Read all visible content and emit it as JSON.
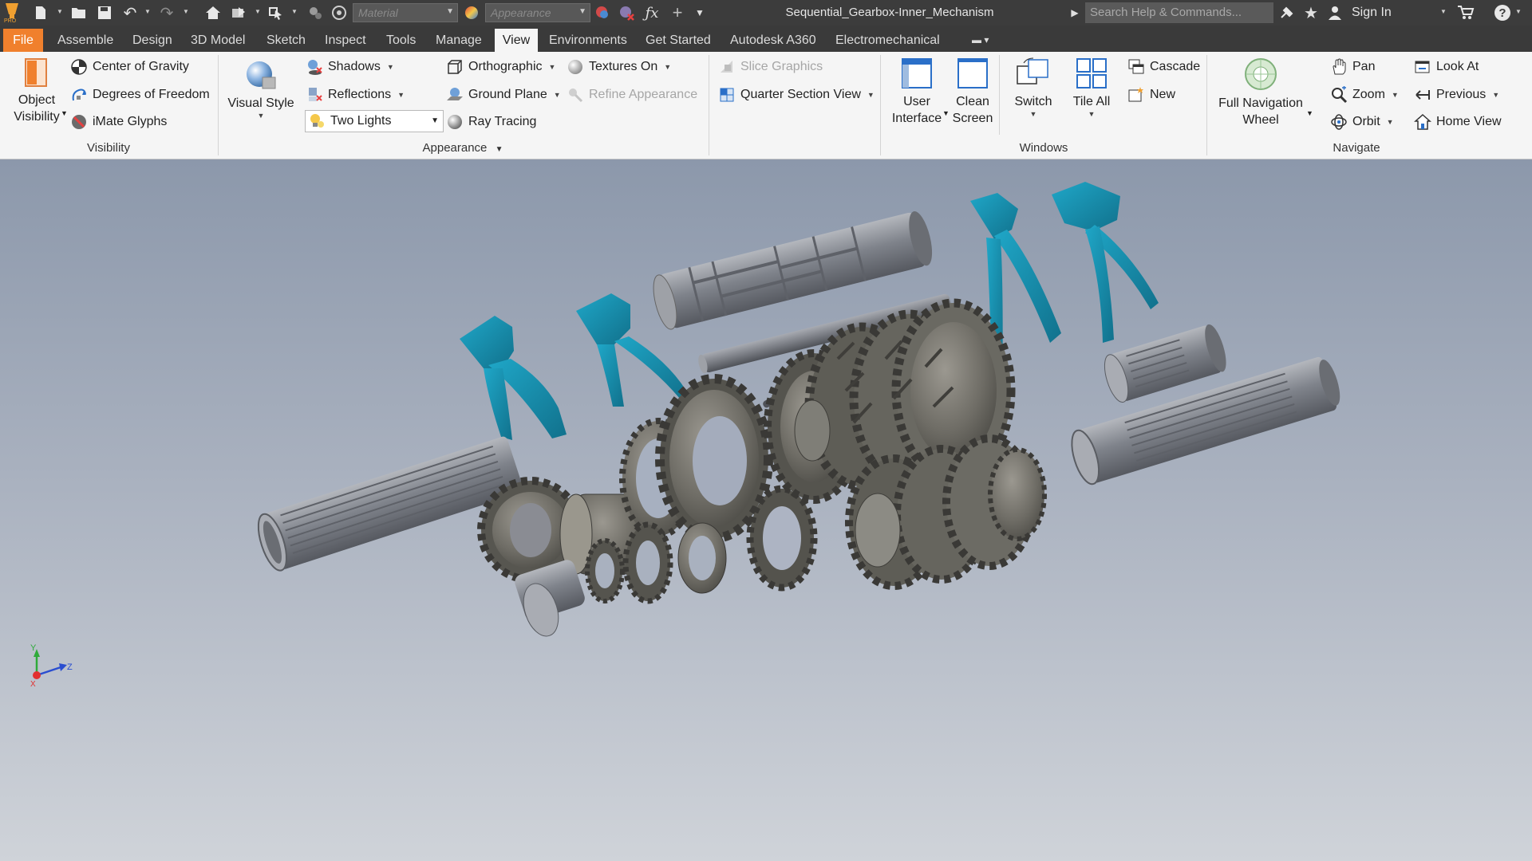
{
  "app": {
    "logo_text": "PRO",
    "doc_title": "Sequential_Gearbox-Inner_Mechanism",
    "search_placeholder": "Search Help & Commands...",
    "sign_in": "Sign In",
    "material_placeholder": "Material",
    "appearance_placeholder": "Appearance"
  },
  "tabs": [
    "File",
    "Assemble",
    "Design",
    "3D Model",
    "Sketch",
    "Inspect",
    "Tools",
    "Manage",
    "View",
    "Environments",
    "Get Started",
    "Autodesk A360",
    "Electromechanical"
  ],
  "active_tab": "View",
  "ribbon": {
    "visibility": {
      "title": "Visibility",
      "object_visibility": [
        "Object",
        "Visibility"
      ],
      "center_of_gravity": "Center of Gravity",
      "degrees_of_freedom": "Degrees of Freedom",
      "imate_glyphs": "iMate Glyphs"
    },
    "appearance": {
      "title": "Appearance",
      "visual_style": "Visual Style",
      "shadows": "Shadows",
      "reflections": "Reflections",
      "lighting_value": "Two Lights",
      "orthographic": "Orthographic",
      "ground_plane": "Ground Plane",
      "ray_tracing": "Ray Tracing",
      "textures_on": "Textures On",
      "refine_appearance": "Refine Appearance",
      "slice_graphics": "Slice Graphics",
      "quarter_section_view": "Quarter Section View"
    },
    "windows": {
      "title": "Windows",
      "user_interface": [
        "User",
        "Interface"
      ],
      "clean_screen": [
        "Clean",
        "Screen"
      ],
      "switch": "Switch",
      "tile_all": "Tile All",
      "cascade": "Cascade",
      "new": "New"
    },
    "navigate": {
      "title": "Navigate",
      "full_navigation_wheel": [
        "Full Navigation",
        "Wheel"
      ],
      "pan": "Pan",
      "zoom": "Zoom",
      "orbit": "Orbit",
      "look_at": "Look At",
      "previous": "Previous",
      "home_view": "Home View"
    }
  },
  "triad": {
    "x": "X",
    "y": "Y",
    "z": "Z"
  },
  "colors": {
    "title_bar": "#3c3c3c",
    "file_tab": "#f0802d",
    "ribbon_bg": "#f5f5f5",
    "shift_fork": "#1787a5",
    "gear_metal": "#6f6e68",
    "shaft_metal": "#8c8f96"
  }
}
